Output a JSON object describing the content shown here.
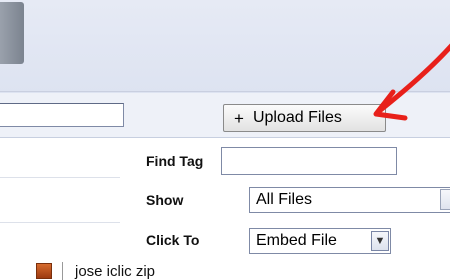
{
  "toolbar": {
    "upload_label": "Upload Files",
    "upload_icon": "plus-icon"
  },
  "filters": {
    "find_tag_label": "Find Tag",
    "find_tag_value": "",
    "show_label": "Show",
    "show_value": "All Files",
    "click_to_label": "Click To",
    "click_to_value": "Embed File"
  },
  "files": [
    {
      "name": "jose iclic zip",
      "icon": "zip-file-icon"
    }
  ],
  "colors": {
    "annotation_arrow": "#e8201a",
    "header_band": "#e6eaf5"
  }
}
